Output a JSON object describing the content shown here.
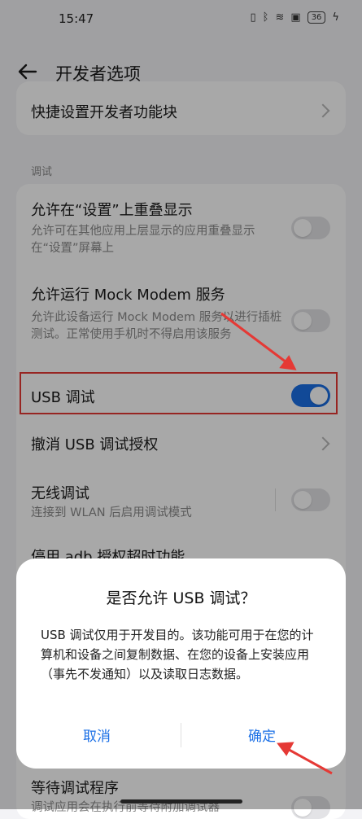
{
  "status_bar": {
    "time": "15:47",
    "battery": "36"
  },
  "app_bar": {
    "title": "开发者选项"
  },
  "top_item": {
    "title": "快捷设置开发者功能块"
  },
  "section": {
    "label": "调试"
  },
  "settings": {
    "overlay": {
      "title": "允许在“设置”上重叠显示",
      "subtitle": "允许可在其他应用上层显示的应用重叠显示在“设置”屏幕上",
      "enabled": false
    },
    "mock_modem": {
      "title": "允许运行 Mock Modem 服务",
      "subtitle": "允许此设备运行 Mock Modem 服务以进行插桩测试。正常使用手机时不得启用该服务",
      "enabled": false
    },
    "usb_debug": {
      "title": "USB 调试",
      "enabled": true
    },
    "revoke_usb": {
      "title": "撤消 USB 调试授权"
    },
    "wireless_debug": {
      "title": "无线调试",
      "subtitle": "连接到 WLAN 后启用调试模式",
      "enabled": false
    },
    "adb_timeout": {
      "title": "停用 adb 授权超时功能"
    },
    "wait_debugger": {
      "title": "等待调试程序",
      "subtitle": "调试应用会在执行前等待附加调试器",
      "enabled": false
    }
  },
  "dialog": {
    "title": "是否允许 USB 调试？",
    "message": "USB 调试仅用于开发目的。该功能可用于在您的计算机和设备之间复制数据、在您的设备上安装应用（事先不发通知）以及读取日志数据。",
    "cancel_label": "取消",
    "confirm_label": "确定"
  },
  "colors": {
    "accent": "#1a6fe6",
    "annotation": "#e53935"
  }
}
